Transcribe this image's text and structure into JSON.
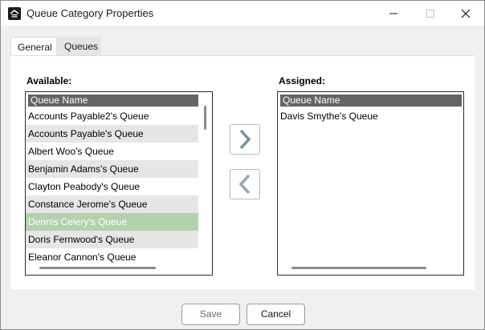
{
  "window": {
    "title": "Queue Category Properties",
    "controls": {
      "minimize": "minimize-icon",
      "maximize": "maximize-icon",
      "close": "close-icon"
    }
  },
  "tabs": [
    {
      "label": "General",
      "active": false
    },
    {
      "label": "Queues",
      "active": true
    }
  ],
  "available": {
    "label": "Available:",
    "column_header": "Queue Name",
    "items": [
      "Accounts Payable2's Queue",
      "Accounts Payable's Queue",
      "Albert Woo's Queue",
      "Benjamin Adams's Queue",
      "Clayton Peabody's Queue",
      "Constance Jerome's Queue",
      "Dennis Celery's Queue",
      "Doris Fernwood's Queue",
      "Eleanor Cannon's Queue"
    ],
    "selected_item": "Dennis Celery's Queue"
  },
  "assigned": {
    "label": "Assigned:",
    "column_header": "Queue Name",
    "items": [
      "Davis Smythe's Queue"
    ]
  },
  "transfer_buttons": {
    "add_icon": "chevron-right-icon",
    "remove_icon": "chevron-left-icon"
  },
  "buttons": {
    "save": "Save",
    "cancel": "Cancel"
  },
  "colors": {
    "header_bg": "#646464",
    "selection_bg": "#b3d1ad",
    "alt_row_bg": "#e6e6e6",
    "arrow_enabled": "#7c8e9a",
    "arrow_disabled": "#9aa4ab"
  }
}
